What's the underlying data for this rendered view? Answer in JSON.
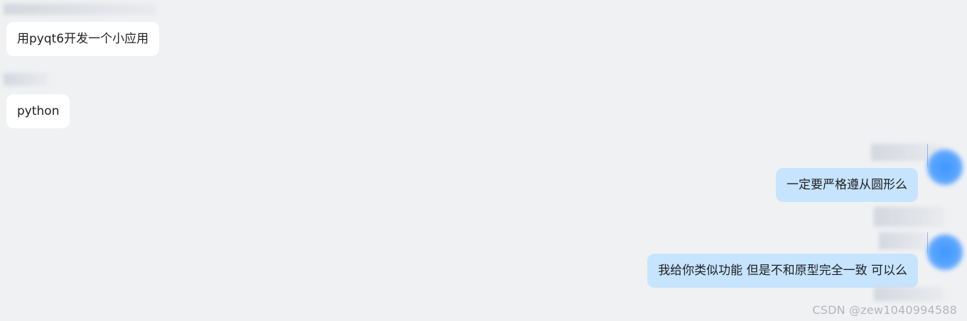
{
  "messages": [
    {
      "side": "left",
      "text": "用pyqt6开发一个小应用"
    },
    {
      "side": "left",
      "text": "python"
    },
    {
      "side": "right",
      "text": "一定要严格遵从圆形么"
    },
    {
      "side": "right",
      "text": "我给你类似功能 但是不和原型完全一致 可以么"
    }
  ],
  "watermark": "CSDN @zew1040994588",
  "colors": {
    "background": "#f0f1f3",
    "left_bubble": "#ffffff",
    "right_bubble": "#c6e4fd",
    "avatar_accent": "#3f97ff"
  }
}
